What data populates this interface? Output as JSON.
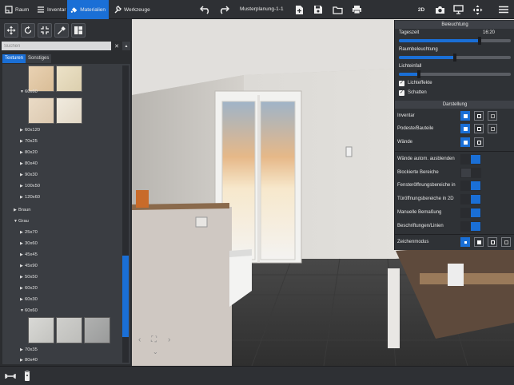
{
  "toolbar": {
    "raum": "Raum",
    "inventar": "Inventar",
    "materialien": "Materialien",
    "werkzeuge": "Werkzeuge",
    "title": "Musterplanung-1-1",
    "view_mode": "2D"
  },
  "search": {
    "placeholder": "Suchen"
  },
  "tabs": {
    "texturen": "Texturen",
    "sonstiges": "Sonstiges"
  },
  "tree": {
    "r_60x60_a": "60x60",
    "r_60x120": "60x120",
    "r_70x25": "70x25",
    "r_80x20": "80x20",
    "r_80x40": "80x40",
    "r_90x30": "90x30",
    "r_100x50": "100x50",
    "r_120x60": "120x60",
    "r_braun": "Braun",
    "r_grau": "Grau",
    "r_25x70": "25x70",
    "r_30x60": "30x60",
    "r_45x45": "45x45",
    "r_45x90": "45x90",
    "r_50x50": "50x50",
    "r_60x20": "60x20",
    "r_60x30": "60x30",
    "r_60x60_b": "60x60",
    "r_70x35": "70x35",
    "r_80x40_b": "80x40"
  },
  "panel": {
    "beleuchtung": "Beleuchtung",
    "tageszeit": "Tageszeit",
    "tageszeit_value": "16:20",
    "tageszeit_level": 0.72,
    "raumbeleuchtung": "Raumbeleuchtung",
    "raumbeleuchtung_level": 0.5,
    "lichteinfall": "Lichteinfall",
    "lichteinfall_level": 0.18,
    "lichteffekte": "Lichteffekte",
    "schatten": "Schatten",
    "darstellung": "Darstellung",
    "inventar": "Inventar",
    "podeste": "Podeste/Bauteile",
    "waende": "Wände",
    "waende_auto": "Wände autom. ausblenden",
    "blockierte": "Blockierte Bereiche",
    "fenster": "Fensteröffnungsbereiche in",
    "tuer": "Türöffnungsbereiche in 2D",
    "bemassung": "Manuelle Bemaßung",
    "beschriftung": "Beschriftungen/Linien",
    "zeichenmodus": "Zeichenmodus"
  },
  "colors": {
    "accent": "#1a6fd6",
    "panel": "#2f3236",
    "bar": "#2e3034"
  }
}
